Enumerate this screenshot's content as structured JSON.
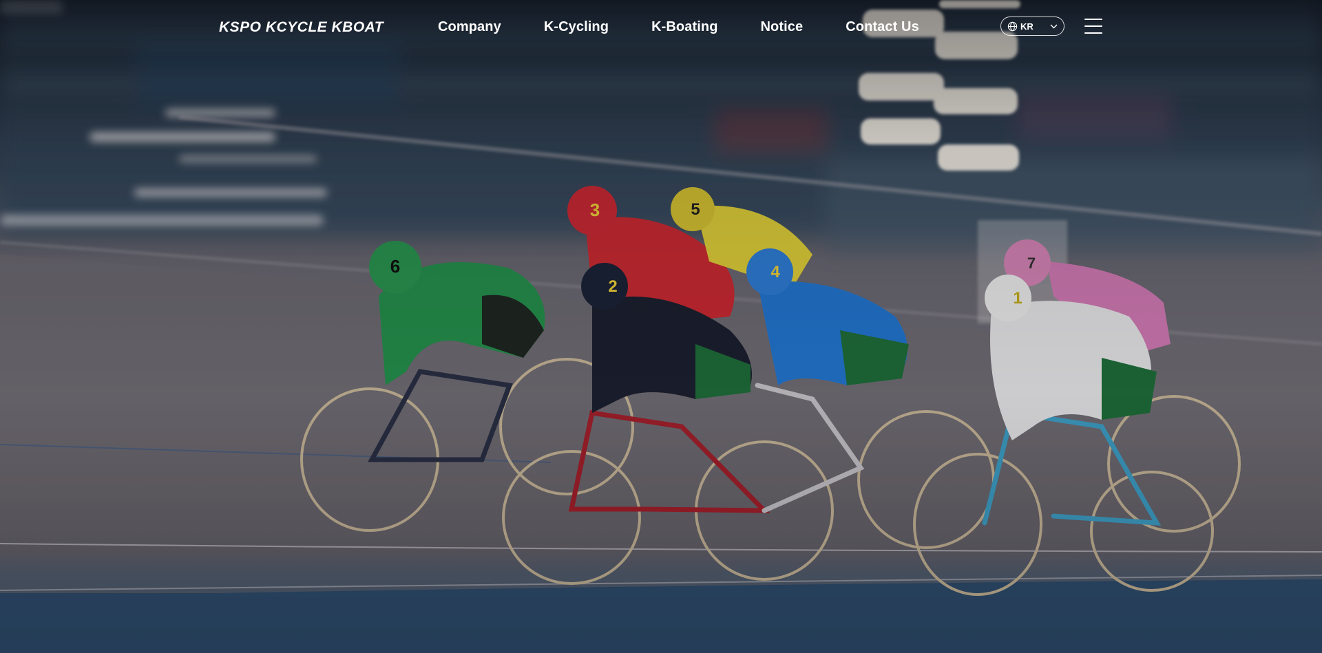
{
  "header": {
    "logo_text": "KSPO KCYCLE KBOAT",
    "nav": [
      {
        "label": "Company"
      },
      {
        "label": "K-Cycling"
      },
      {
        "label": "K-Boating"
      },
      {
        "label": "Notice"
      },
      {
        "label": "Contact Us"
      }
    ],
    "language": {
      "selected": "KR",
      "icon": "globe-icon"
    },
    "menu_icon": "hamburger-menu-icon"
  },
  "hero": {
    "image": "track-cycling-race-photo",
    "riders": [
      "6",
      "3",
      "5",
      "2",
      "4",
      "1",
      "7"
    ]
  },
  "colors": {
    "text": "#ffffff",
    "track": "#6e6a72",
    "rail": "#2f4d6e"
  }
}
